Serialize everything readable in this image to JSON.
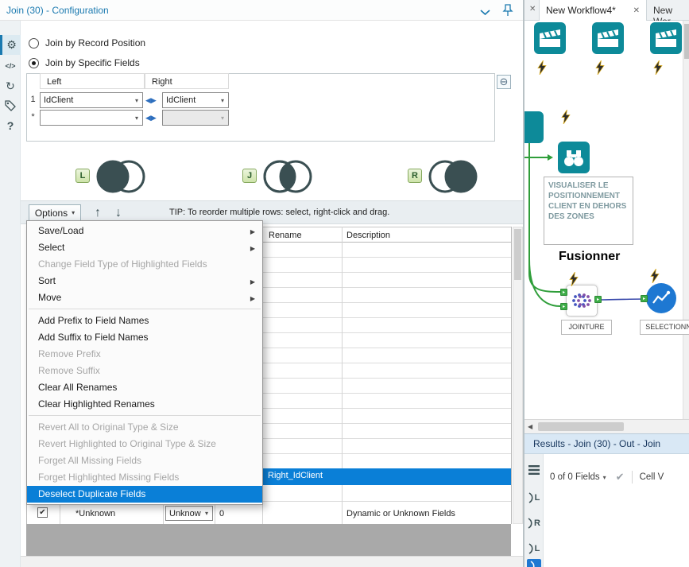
{
  "icons": {
    "close": "✕",
    "caret_down": "▾",
    "up_arrow": "↑",
    "down_arrow": "↓",
    "remove": "⊖",
    "check": "✔",
    "swap_left": "◀",
    "swap_right": "▶",
    "submenu_arrow": "▶",
    "gear": "⚙",
    "code": "</>",
    "refresh": "↻",
    "help": "?",
    "scroll_left": "◀",
    "anchor_arrow": "▸"
  },
  "config": {
    "title": "Join (30) - Configuration",
    "join_by_position": "Join by Record Position",
    "join_by_fields": "Join by Specific Fields",
    "fields_table": {
      "left_header": "Left",
      "right_header": "Right",
      "row1_num": "1",
      "row1_left": "IdClient",
      "row1_right": "IdClient",
      "row2_num": "*"
    },
    "venn": {
      "l": "L",
      "j": "J",
      "r": "R"
    },
    "options_button": "Options",
    "tip": "TIP: To reorder multiple rows: select, right-click and drag.",
    "grid": {
      "rename_header": "Rename",
      "description_header": "Description",
      "selected_rename": "Right_IdClient",
      "unknown_field": "*Unknown",
      "unknown_type": "Unknown",
      "unknown_size": "0",
      "unknown_description": "Dynamic or Unknown Fields"
    },
    "menu": {
      "items": [
        "Save/Load",
        "Select",
        "Change Field Type of Highlighted Fields",
        "Sort",
        "Move",
        "Add Prefix to Field Names",
        "Add Suffix to Field Names",
        "Remove Prefix",
        "Remove Suffix",
        "Clear All Renames",
        "Clear Highlighted Renames",
        "Revert All to Original Type & Size",
        "Revert Highlighted to Original Type & Size",
        "Forget All Missing Fields",
        "Forget Highlighted Missing Fields",
        "Deselect Duplicate Fields"
      ]
    }
  },
  "canvas": {
    "active_tab": "New Workflow4*",
    "next_tab": "New Wor",
    "comment": "VISUALISER LE POSITIONNEMENT CLIENT EN DEHORS DES ZONES",
    "fusionner": "Fusionner",
    "jointure": "JOINTURE",
    "selection": "SELECTIONN"
  },
  "results": {
    "title": "Results - Join (30) - Out - Join",
    "fields_count": "0 of 0 Fields",
    "cell_viewer": "Cell V",
    "anchors": [
      "L",
      "R",
      "L"
    ]
  }
}
